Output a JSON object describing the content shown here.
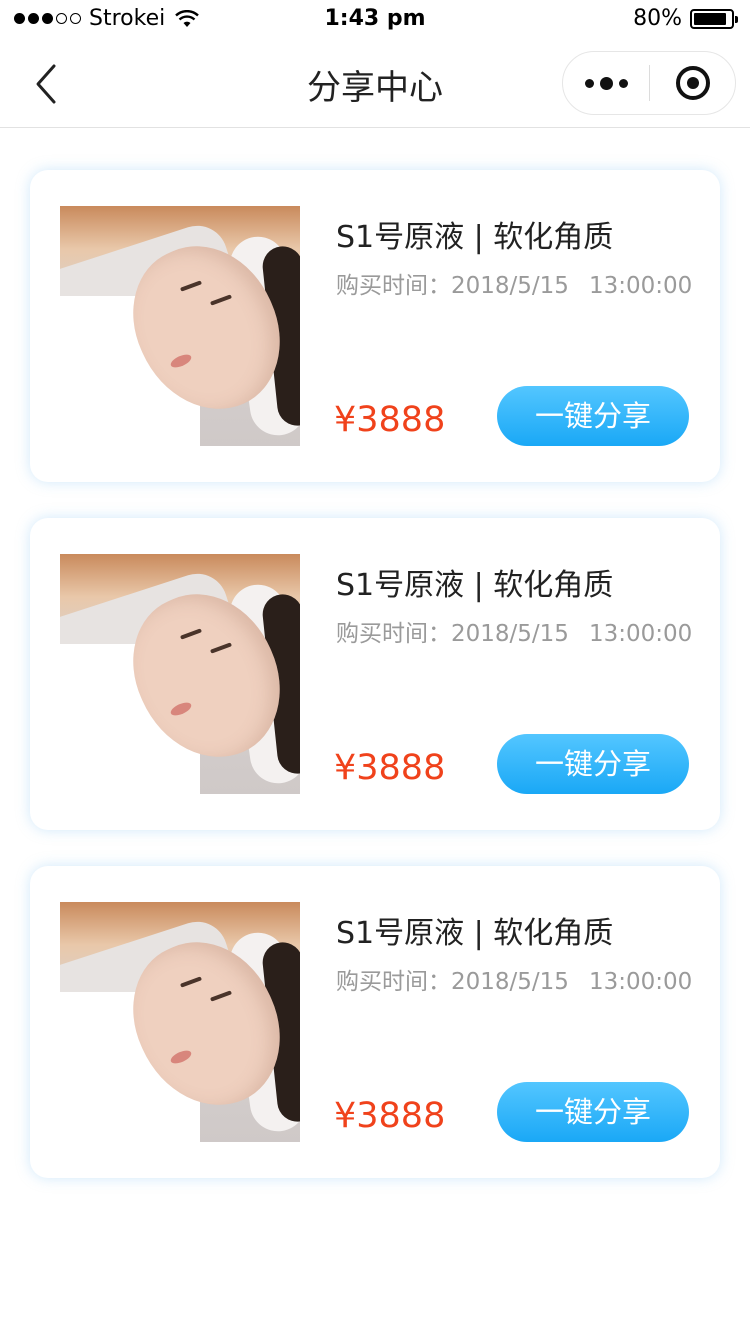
{
  "status_bar": {
    "carrier": "Strokei",
    "time": "1:43 pm",
    "battery": "80%",
    "signal_icon": "signal-dots-icon",
    "wifi_icon": "wifi-icon",
    "battery_icon": "battery-icon"
  },
  "nav": {
    "title": "分享中心",
    "back_icon": "chevron-left-icon",
    "more_icon": "more-dots-icon",
    "close_icon": "target-circle-icon"
  },
  "products": [
    {
      "title": "S1号原液 | 软化角质",
      "time_label": "购买时间：",
      "date": "2018/5/15",
      "time": "13:00:00",
      "price": "¥3888",
      "share_label": "一键分享",
      "image": "facial-mask-photo"
    },
    {
      "title": "S1号原液 | 软化角质",
      "time_label": "购买时间：",
      "date": "2018/5/15",
      "time": "13:00:00",
      "price": "¥3888",
      "share_label": "一键分享",
      "image": "facial-mask-photo"
    },
    {
      "title": "S1号原液 | 软化角质",
      "time_label": "购买时间：",
      "date": "2018/5/15",
      "time": "13:00:00",
      "price": "¥3888",
      "share_label": "一键分享",
      "image": "facial-mask-photo"
    }
  ],
  "colors": {
    "price": "#f0421b",
    "button_top": "#53c6ff",
    "button_bottom": "#1aa8f6",
    "muted_text": "#9a9a9a"
  }
}
